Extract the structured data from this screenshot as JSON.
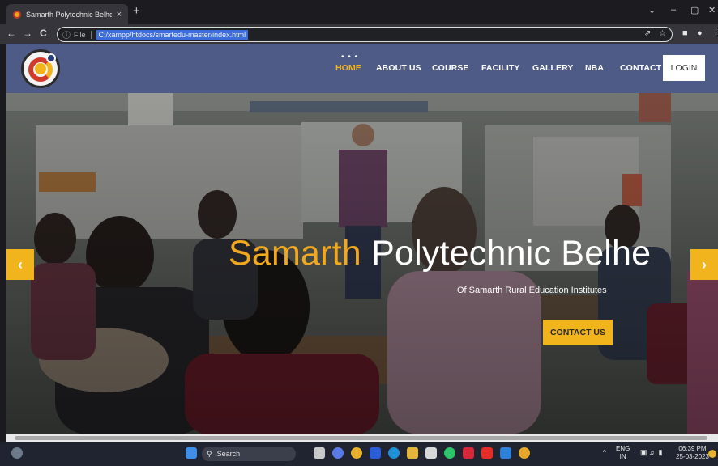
{
  "browser": {
    "tab_title": "Samarth Polytechnic Belhe",
    "tab_close": "×",
    "new_tab": "+",
    "minimize": "⌄",
    "restore": "–",
    "maximize": "▢",
    "close": "✕",
    "back": "←",
    "forward": "→",
    "reload": "C",
    "info_icon": "ⓘ",
    "file_label": "File",
    "url": "C:/xampp/htdocs/smartedu-master/index.html",
    "share_icon": "⇗",
    "bookmark_icon": "☆"
  },
  "site": {
    "nav": {
      "items": [
        {
          "label": "HOME",
          "active": true
        },
        {
          "label": "ABOUT US",
          "active": false
        },
        {
          "label": "COURSE",
          "active": false
        },
        {
          "label": "FACILITY",
          "active": false
        },
        {
          "label": "GALLERY",
          "active": false
        },
        {
          "label": "NBA",
          "active": false
        },
        {
          "label": "CONTACT",
          "active": false
        }
      ],
      "login": "LOGIN",
      "dots": "• • •"
    },
    "hero": {
      "title_accent": "Samarth",
      "title_rest": " Polytechnic Belhe",
      "subtitle": "Of Samarth Rural Education Institutes",
      "cta": "CONTACT US",
      "prev": "‹",
      "next": "›"
    },
    "colors": {
      "header": "#4e5b86",
      "accent": "#f1b41c"
    }
  },
  "taskbar": {
    "search_label": "Search",
    "lang_1": "ENG",
    "lang_2": "IN",
    "time": "06:39 PM",
    "date": "25-03-2023",
    "chevron": "^"
  }
}
